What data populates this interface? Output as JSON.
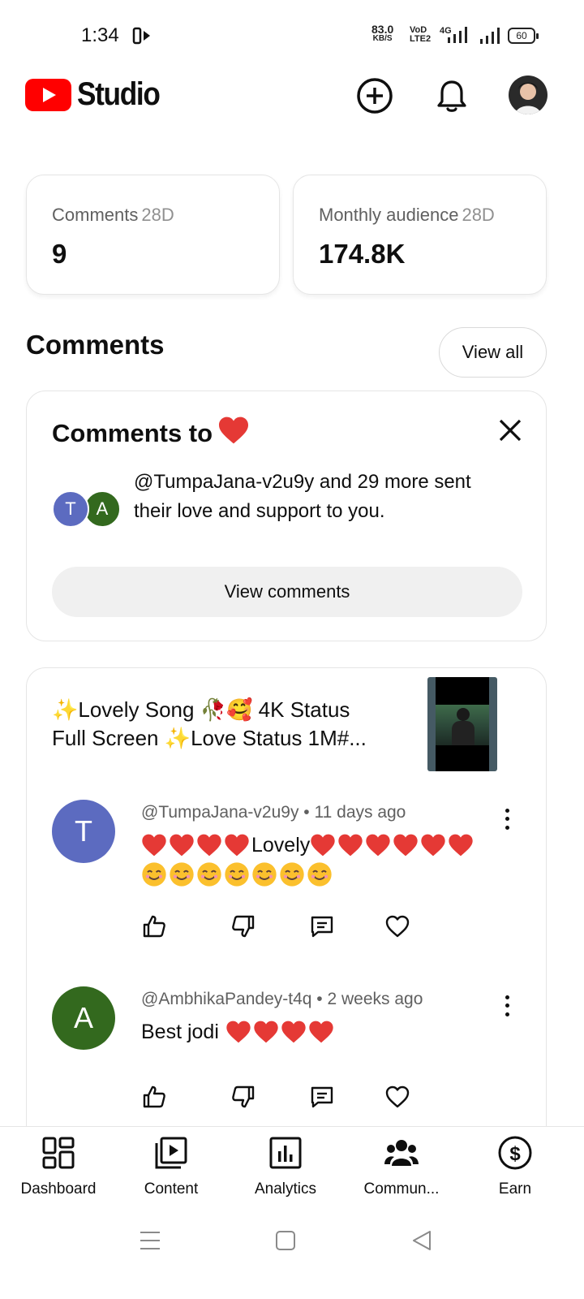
{
  "status_bar": {
    "time": "1:34",
    "net_speed_value": "83.0",
    "net_speed_unit": "KB/S",
    "volte_top": "VoD",
    "volte_bottom": "LTE2",
    "network": "4G",
    "battery": "60"
  },
  "header": {
    "app_name": "Studio"
  },
  "stats": [
    {
      "label": "Comments",
      "period": "28D",
      "value": "9"
    },
    {
      "label": "Monthly audience",
      "period": "28D",
      "value": "174.8K"
    }
  ],
  "comments_section": {
    "title": "Comments",
    "view_all_label": "View all"
  },
  "love_card": {
    "title": "Comments to",
    "text": "@TumpaJana-v2u9y and 29 more sent their love and support to you.",
    "avatar_1": "T",
    "avatar_2": "A",
    "button_label": "View comments"
  },
  "video": {
    "title_line1": "✨Lovely Song 🥀🥰 4K Status",
    "title_line2": "Full Screen ✨Love Status 1M#..."
  },
  "comments": [
    {
      "initial": "T",
      "author": "@TumpaJana-v2u9y",
      "time": "11 days ago",
      "text_word": "Lovely",
      "hearts_before": 4,
      "hearts_after": 6,
      "smileys": 7
    },
    {
      "initial": "A",
      "author": "@AmbhikaPandey-t4q",
      "time": "2 weeks ago",
      "text_word": "Best jodi",
      "hearts_after": 4
    }
  ],
  "bottom_nav": [
    {
      "label": "Dashboard",
      "icon": "dashboard-icon"
    },
    {
      "label": "Content",
      "icon": "content-icon"
    },
    {
      "label": "Analytics",
      "icon": "analytics-icon"
    },
    {
      "label": "Commun...",
      "icon": "community-icon"
    },
    {
      "label": "Earn",
      "icon": "earn-icon"
    }
  ],
  "colors": {
    "brand_red": "#ff0000",
    "avatar_t": "#5c6bc0",
    "avatar_a": "#33691e",
    "heart": "#e53935"
  }
}
